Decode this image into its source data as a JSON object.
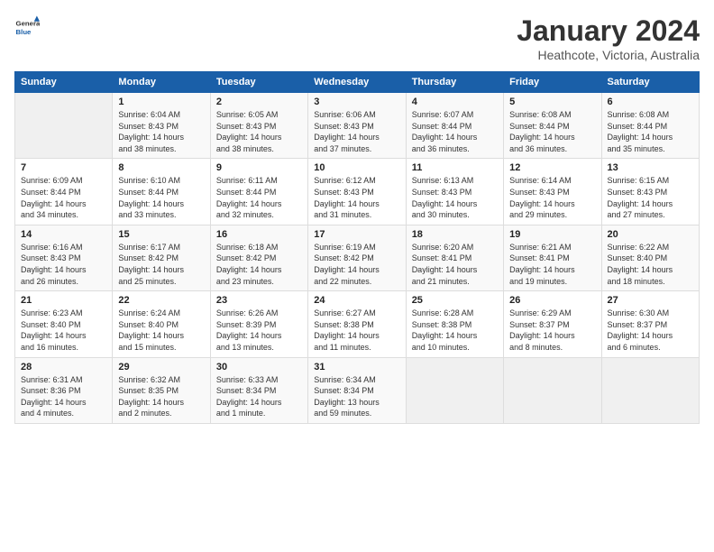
{
  "header": {
    "logo_line1": "General",
    "logo_line2": "Blue",
    "month_title": "January 2024",
    "location": "Heathcote, Victoria, Australia"
  },
  "days_of_week": [
    "Sunday",
    "Monday",
    "Tuesday",
    "Wednesday",
    "Thursday",
    "Friday",
    "Saturday"
  ],
  "weeks": [
    [
      {
        "num": "",
        "empty": true
      },
      {
        "num": "1",
        "sunrise": "6:04 AM",
        "sunset": "8:43 PM",
        "daylight": "14 hours and 38 minutes."
      },
      {
        "num": "2",
        "sunrise": "6:05 AM",
        "sunset": "8:43 PM",
        "daylight": "14 hours and 38 minutes."
      },
      {
        "num": "3",
        "sunrise": "6:06 AM",
        "sunset": "8:43 PM",
        "daylight": "14 hours and 37 minutes."
      },
      {
        "num": "4",
        "sunrise": "6:07 AM",
        "sunset": "8:44 PM",
        "daylight": "14 hours and 36 minutes."
      },
      {
        "num": "5",
        "sunrise": "6:08 AM",
        "sunset": "8:44 PM",
        "daylight": "14 hours and 36 minutes."
      },
      {
        "num": "6",
        "sunrise": "6:08 AM",
        "sunset": "8:44 PM",
        "daylight": "14 hours and 35 minutes."
      }
    ],
    [
      {
        "num": "7",
        "sunrise": "6:09 AM",
        "sunset": "8:44 PM",
        "daylight": "14 hours and 34 minutes."
      },
      {
        "num": "8",
        "sunrise": "6:10 AM",
        "sunset": "8:44 PM",
        "daylight": "14 hours and 33 minutes."
      },
      {
        "num": "9",
        "sunrise": "6:11 AM",
        "sunset": "8:44 PM",
        "daylight": "14 hours and 32 minutes."
      },
      {
        "num": "10",
        "sunrise": "6:12 AM",
        "sunset": "8:43 PM",
        "daylight": "14 hours and 31 minutes."
      },
      {
        "num": "11",
        "sunrise": "6:13 AM",
        "sunset": "8:43 PM",
        "daylight": "14 hours and 30 minutes."
      },
      {
        "num": "12",
        "sunrise": "6:14 AM",
        "sunset": "8:43 PM",
        "daylight": "14 hours and 29 minutes."
      },
      {
        "num": "13",
        "sunrise": "6:15 AM",
        "sunset": "8:43 PM",
        "daylight": "14 hours and 27 minutes."
      }
    ],
    [
      {
        "num": "14",
        "sunrise": "6:16 AM",
        "sunset": "8:43 PM",
        "daylight": "14 hours and 26 minutes."
      },
      {
        "num": "15",
        "sunrise": "6:17 AM",
        "sunset": "8:42 PM",
        "daylight": "14 hours and 25 minutes."
      },
      {
        "num": "16",
        "sunrise": "6:18 AM",
        "sunset": "8:42 PM",
        "daylight": "14 hours and 23 minutes."
      },
      {
        "num": "17",
        "sunrise": "6:19 AM",
        "sunset": "8:42 PM",
        "daylight": "14 hours and 22 minutes."
      },
      {
        "num": "18",
        "sunrise": "6:20 AM",
        "sunset": "8:41 PM",
        "daylight": "14 hours and 21 minutes."
      },
      {
        "num": "19",
        "sunrise": "6:21 AM",
        "sunset": "8:41 PM",
        "daylight": "14 hours and 19 minutes."
      },
      {
        "num": "20",
        "sunrise": "6:22 AM",
        "sunset": "8:40 PM",
        "daylight": "14 hours and 18 minutes."
      }
    ],
    [
      {
        "num": "21",
        "sunrise": "6:23 AM",
        "sunset": "8:40 PM",
        "daylight": "14 hours and 16 minutes."
      },
      {
        "num": "22",
        "sunrise": "6:24 AM",
        "sunset": "8:40 PM",
        "daylight": "14 hours and 15 minutes."
      },
      {
        "num": "23",
        "sunrise": "6:26 AM",
        "sunset": "8:39 PM",
        "daylight": "14 hours and 13 minutes."
      },
      {
        "num": "24",
        "sunrise": "6:27 AM",
        "sunset": "8:38 PM",
        "daylight": "14 hours and 11 minutes."
      },
      {
        "num": "25",
        "sunrise": "6:28 AM",
        "sunset": "8:38 PM",
        "daylight": "14 hours and 10 minutes."
      },
      {
        "num": "26",
        "sunrise": "6:29 AM",
        "sunset": "8:37 PM",
        "daylight": "14 hours and 8 minutes."
      },
      {
        "num": "27",
        "sunrise": "6:30 AM",
        "sunset": "8:37 PM",
        "daylight": "14 hours and 6 minutes."
      }
    ],
    [
      {
        "num": "28",
        "sunrise": "6:31 AM",
        "sunset": "8:36 PM",
        "daylight": "14 hours and 4 minutes."
      },
      {
        "num": "29",
        "sunrise": "6:32 AM",
        "sunset": "8:35 PM",
        "daylight": "14 hours and 2 minutes."
      },
      {
        "num": "30",
        "sunrise": "6:33 AM",
        "sunset": "8:34 PM",
        "daylight": "14 hours and 1 minute."
      },
      {
        "num": "31",
        "sunrise": "6:34 AM",
        "sunset": "8:34 PM",
        "daylight": "13 hours and 59 minutes."
      },
      {
        "num": "",
        "empty": true
      },
      {
        "num": "",
        "empty": true
      },
      {
        "num": "",
        "empty": true
      }
    ]
  ]
}
